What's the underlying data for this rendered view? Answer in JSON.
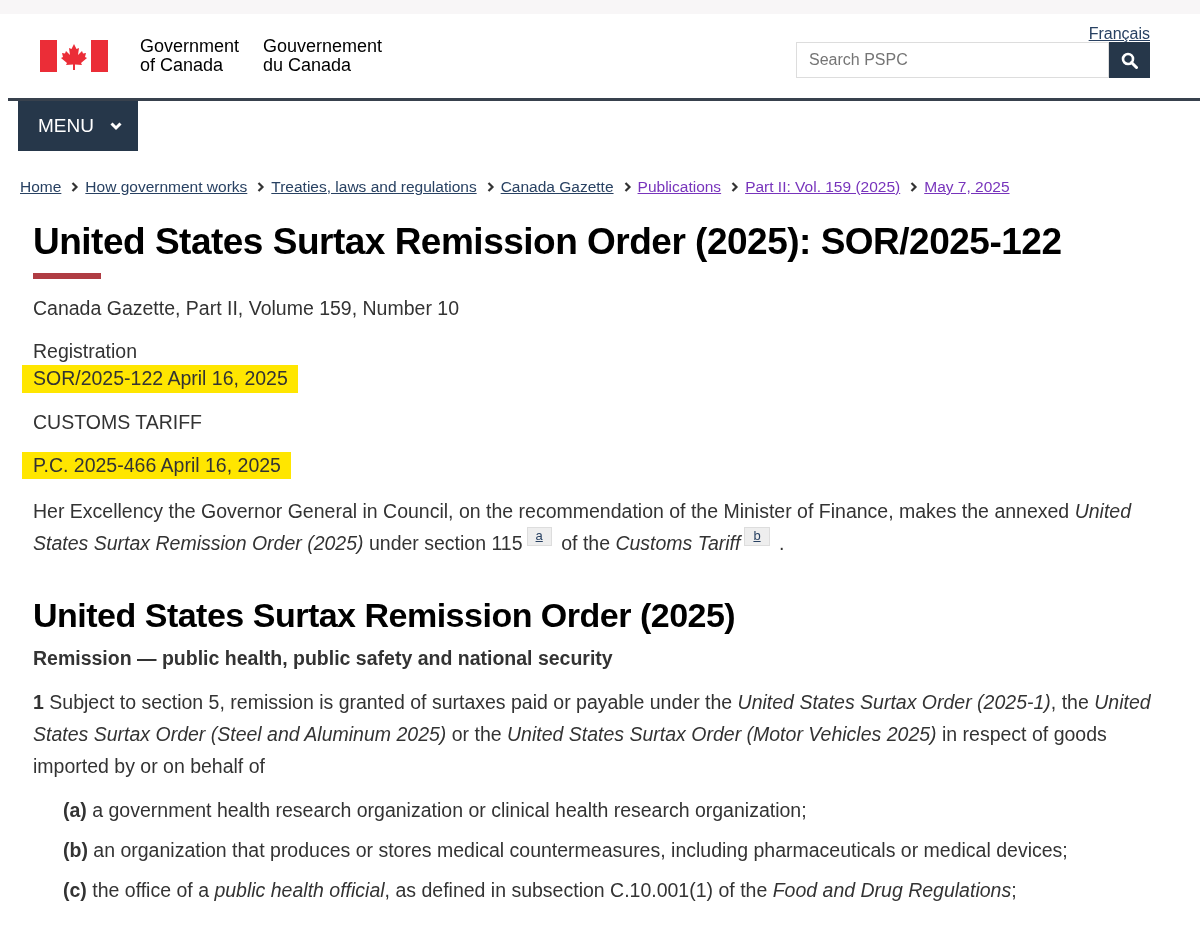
{
  "language_link": "Français",
  "brand": {
    "english": [
      "Government",
      "of Canada"
    ],
    "french": [
      "Gouvernement",
      "du Canada"
    ]
  },
  "search": {
    "placeholder": "Search PSPC"
  },
  "menu": {
    "label": "MENU",
    "expanded": false
  },
  "breadcrumbs": [
    {
      "label": "Home",
      "visited": false
    },
    {
      "label": "How government works",
      "visited": false
    },
    {
      "label": "Treaties, laws and regulations",
      "visited": false
    },
    {
      "label": "Canada Gazette",
      "visited": false
    },
    {
      "label": "Publications",
      "visited": true
    },
    {
      "label": "Part II: Vol. 159 (2025)",
      "visited": true
    },
    {
      "label": "May 7, 2025",
      "visited": true
    }
  ],
  "title": "United States Surtax Remission Order (2025): SOR/2025-122",
  "meta_groups": [
    [
      {
        "text": "Canada Gazette, Part II, Volume 159, Number 10",
        "highlighted": false
      }
    ],
    [
      {
        "text": "Registration",
        "highlighted": false
      },
      {
        "text": "SOR/2025-122 April 16, 2025",
        "highlighted": true
      }
    ],
    [
      {
        "text": "CUSTOMS TARIFF",
        "highlighted": false
      }
    ],
    [
      {
        "text": "P.C. 2025-466 April 16, 2025",
        "highlighted": true
      }
    ]
  ],
  "preamble": [
    {
      "kind": "text",
      "text": "Her Excellency the Governor General in Council, on the recommendation of the Minister of Finance, makes the annexed *United States Surtax Remission Order (2025)* under section 115"
    },
    {
      "kind": "footnote",
      "text": "a"
    },
    {
      "kind": "text",
      "text": "of the *Customs Tariff*"
    },
    {
      "kind": "footnote",
      "text": "b"
    },
    {
      "kind": "text",
      "text": "."
    }
  ],
  "order": {
    "heading": "United States Surtax Remission Order (2025)",
    "subheading": "Remission — public health, public safety and national security",
    "section": "**1** Subject to section 5, remission is granted of surtaxes paid or payable under the *United States Surtax Order (2025-1)*, the *United States Surtax Order (Steel and Aluminum 2025)* or the *United States Surtax Order (Motor Vehicles 2025)* in respect of goods imported by or on behalf of",
    "paragraphs": [
      "**(a)** a government health research organization or clinical health research organization;",
      "**(b)** an organization that produces or stores medical countermeasures, including pharmaceuticals or medical devices;",
      "**(c)** the office of a *public health official*, as defined in subsection C.10.001(1) of the *Food and Drug Regulations*;"
    ]
  }
}
